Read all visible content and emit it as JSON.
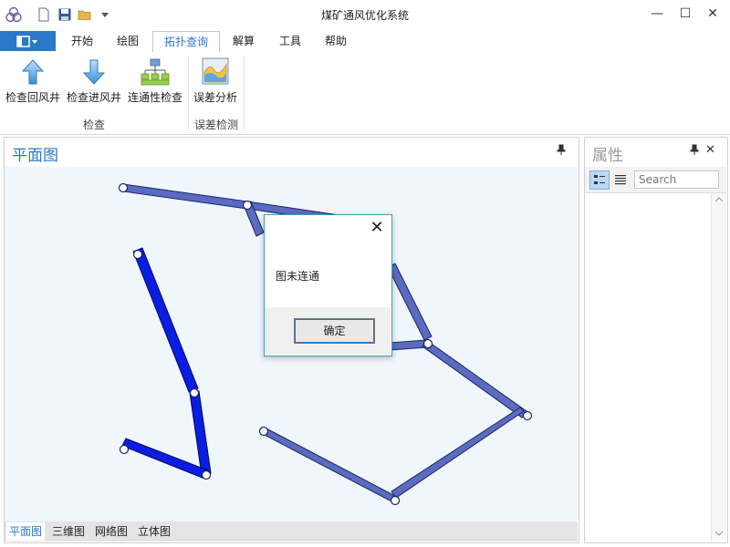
{
  "window": {
    "title": "煤矿通风优化系统",
    "controls": {
      "minimize": "—",
      "maximize": "☐",
      "close": "✕"
    }
  },
  "ribbon": {
    "tabs": [
      {
        "label": "开始"
      },
      {
        "label": "绘图"
      },
      {
        "label": "拓扑查询",
        "active": true
      },
      {
        "label": "解算"
      },
      {
        "label": "工具"
      },
      {
        "label": "帮助"
      }
    ],
    "buttons": [
      {
        "label": "检查回风井",
        "icon": "arrow-up-icon"
      },
      {
        "label": "检查进风井",
        "icon": "arrow-down-icon"
      },
      {
        "label": "连通性检查",
        "icon": "network-tree-icon"
      },
      {
        "label": "误差分析",
        "icon": "area-chart-icon"
      }
    ],
    "groups": [
      {
        "label": "检查"
      },
      {
        "label": "误差检测"
      }
    ]
  },
  "left_panel": {
    "title": "平面图",
    "pin": "📌",
    "bottom_tabs": [
      {
        "label": "平面图",
        "active": true
      },
      {
        "label": "三维图"
      },
      {
        "label": "网络图"
      },
      {
        "label": "立体图"
      }
    ]
  },
  "right_panel": {
    "title": "属性",
    "pin": "📌",
    "close": "✕",
    "search_placeholder": "Search"
  },
  "dialog": {
    "close": "✕",
    "message": "图未连通",
    "ok_label": "确定"
  },
  "colors": {
    "accent": "#2b78c9",
    "edge_fill": "#5b6bc0",
    "edge_fill_highlight": "#0a1de0",
    "canvas_bg": "#eff6fc"
  }
}
